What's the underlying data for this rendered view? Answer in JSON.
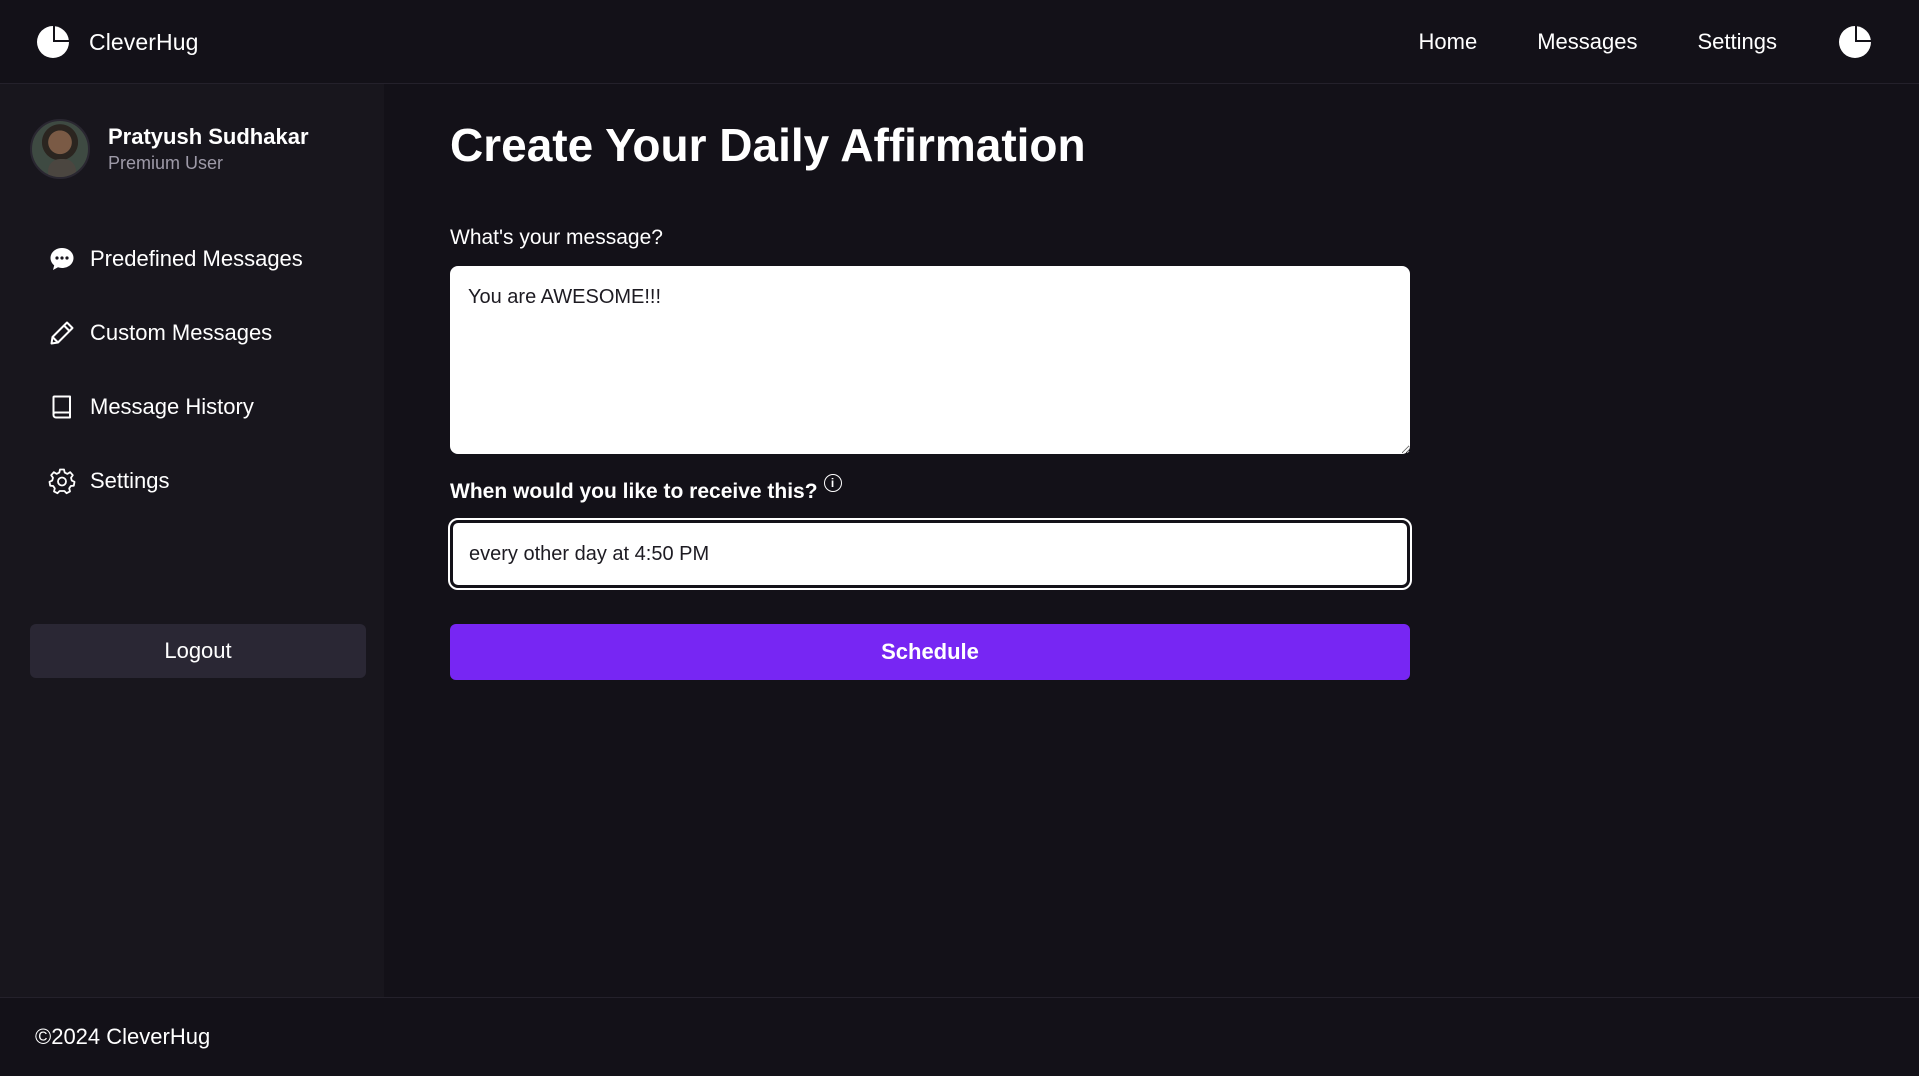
{
  "brand": {
    "name": "CleverHug"
  },
  "nav": {
    "items": [
      {
        "label": "Home"
      },
      {
        "label": "Messages"
      },
      {
        "label": "Settings"
      }
    ]
  },
  "profile": {
    "name": "Pratyush Sudhakar",
    "role": "Premium User"
  },
  "sidebar": {
    "items": [
      {
        "label": "Predefined Messages",
        "icon": "chat-bubble-icon"
      },
      {
        "label": "Custom Messages",
        "icon": "pencil-icon"
      },
      {
        "label": "Message History",
        "icon": "book-icon"
      },
      {
        "label": "Settings",
        "icon": "gear-icon"
      }
    ],
    "logout_label": "Logout"
  },
  "main": {
    "title": "Create Your Daily Affirmation",
    "message_label": "What's your message?",
    "message_value": "You are AWESOME!!!",
    "schedule_label": "When would you like to receive this?",
    "schedule_value": "every other day at 4:50 PM",
    "schedule_button": "Schedule"
  },
  "footer": {
    "text": "©2024 CleverHug"
  },
  "colors": {
    "background": "#131118",
    "sidebar": "#18161d",
    "accent": "#7726f3",
    "logout_button": "#2a2734"
  }
}
